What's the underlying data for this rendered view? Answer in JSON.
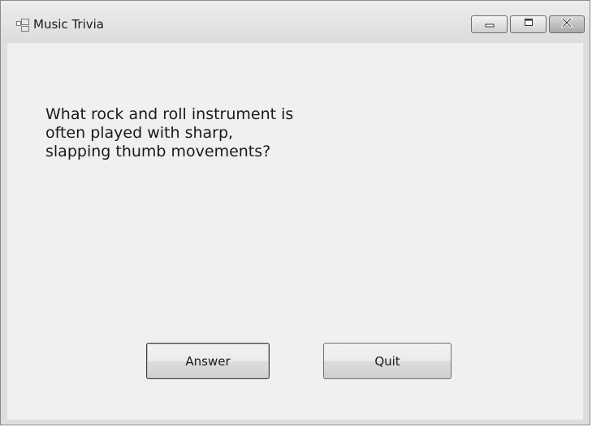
{
  "window": {
    "title": "Music Trivia",
    "icon": "app-window-icon",
    "controls": {
      "minimize_icon": "minimize-icon",
      "maximize_icon": "maximize-icon",
      "close_icon": "close-icon"
    }
  },
  "main": {
    "question": "What rock and roll instrument is often played with sharp, slapping thumb movements?",
    "answer_button": "Answer",
    "quit_button": "Quit"
  }
}
